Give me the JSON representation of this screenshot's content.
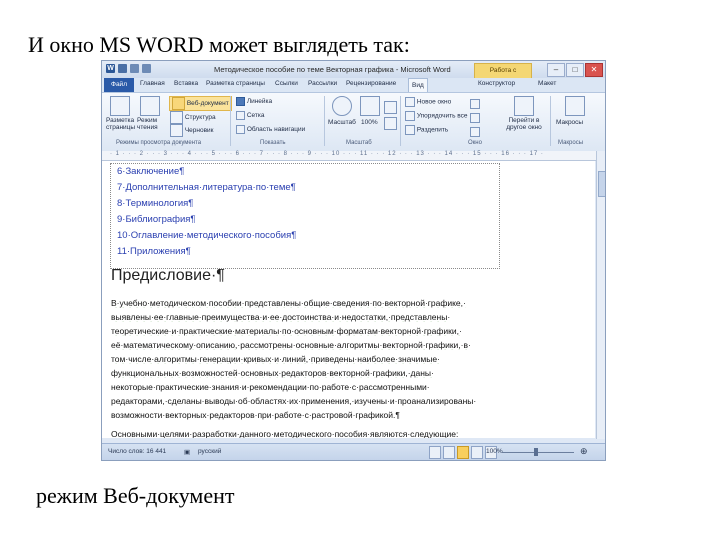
{
  "slide": {
    "title": "И окно MS WORD может выглядеть так:",
    "caption": "режим Веб-документ"
  },
  "window": {
    "title": "Методическое пособие по теме Векторная графика - Microsoft Word",
    "context_tab": "Работа с таблицами",
    "qat_word_icon": "W"
  },
  "tabs": [
    "Файл",
    "Главная",
    "Вставка",
    "Разметка страницы",
    "Ссылки",
    "Рассылки",
    "Рецензирование",
    "Вид",
    "Конструктор",
    "Макет"
  ],
  "ribbon": {
    "view_modes": {
      "print_layout": "Разметка страницы",
      "reading_mode": "Режим чтения",
      "web_document": "Веб-документ",
      "structure": "Структура",
      "draft": "Черновик",
      "group_label": "Режимы просмотра документа"
    },
    "show": {
      "ruler": "Линейка",
      "grid": "Сетка",
      "nav_pane": "Область навигации",
      "group_label": "Показать"
    },
    "zoom": {
      "zoom": "Масштаб",
      "percent": "100%",
      "group_label": "Масштаб"
    },
    "window_group": {
      "new_window": "Новое окно",
      "arrange": "Упорядочить все",
      "split": "Разделить",
      "switch": "Перейти в другое окно",
      "group_label": "Окно"
    },
    "macros": {
      "label": "Макросы",
      "group_label": "Макросы"
    }
  },
  "document": {
    "toc": [
      "6·Заключение¶",
      "7·Дополнительная·литература·по·теме¶",
      "8·Терминология¶",
      "9·Библиография¶",
      "10·Оглавление·методического·пособия¶",
      "11·Приложения¶"
    ],
    "heading": "Предисловие·¶",
    "paragraph_lines": [
      "В·учебно·методическом·пособии·представлены·общие·сведения·по·векторной·графике,·",
      "выявлены·ее·главные·преимущества·и·ее·достоинства·и·недостатки,·представлены·",
      "теоретические·и·практические·материалы·по·основным·форматам·векторной·графики,·",
      "её·математическому·описанию,·рассмотрены·основные·алгоритмы·векторной·графики,·в·",
      "том·числе·алгоритмы·генерации·кривых·и·линий,·приведены·наиболее·значимые·",
      "функциональных·возможностей·основных·редакторов·векторной·графики,·даны·",
      "некоторые·практические·знания·и·рекомендации·по·работе·с·рассмотренными·",
      "редакторами,·сделаны·выводы·об·областях·их·применения,·изучены·и·проанализированы·",
      "возможности·векторных·редакторов·при·работе·с·растровой·графикой.¶",
      "Основными·целями·разработки·данного·методического·пособия·являются·следующие:"
    ]
  },
  "statusbar": {
    "words": "Число слов: 16 441",
    "language": "русский",
    "zoom_percent": "100%"
  },
  "ruler": {
    "ticks": "· 1 · ·  · 2 · ·  · 3 · ·  · 4 · ·  · 5 · ·  · 6 · ·  · 7 · ·  · 8 · ·  · 9 · ·  · 10 · ·  · 11 · ·  · 12 · ·  · 13 · ·  · 14 · ·  · 15 · ·  · 16 · ·  · 17 ·"
  }
}
